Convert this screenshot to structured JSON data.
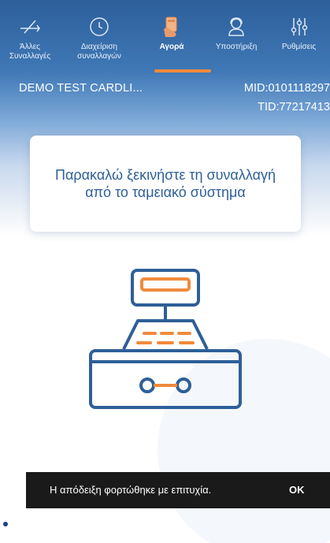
{
  "nav": {
    "items": [
      {
        "label_1": "Άλλες",
        "label_2": "Συναλλαγές",
        "icon": "transactions-arrows-icon"
      },
      {
        "label_1": "Διαχείριση",
        "label_2": "συναλλαγών",
        "icon": "clock-icon"
      },
      {
        "label_1": "Αγορά",
        "label_2": "",
        "icon": "hand-card-icon"
      },
      {
        "label_1": "Υποστήριξη",
        "label_2": "",
        "icon": "support-agent-icon"
      },
      {
        "label_1": "Ρυθμίσεις",
        "label_2": "",
        "icon": "sliders-icon"
      }
    ],
    "active_index": 2
  },
  "merchant": {
    "name": "DEMO TEST CARDLI...",
    "mid": "MID:0101118297",
    "tid": "TID:77217413"
  },
  "message": {
    "text": "Παρακαλώ ξεκινήστε τη συναλλαγή από το ταμειακό σύστημα"
  },
  "illustration": {
    "icon": "cash-register-icon"
  },
  "snackbar": {
    "text": "Η απόδειξη φορτώθηκε με επιτυχία.",
    "action": "OK"
  },
  "colors": {
    "header_blue": "#2d5f9a",
    "accent_orange": "#f08a3c",
    "illustration_blue": "#2e5f98",
    "text_blue": "#2e5f98",
    "snackbar_bg": "#1a1a1a"
  }
}
